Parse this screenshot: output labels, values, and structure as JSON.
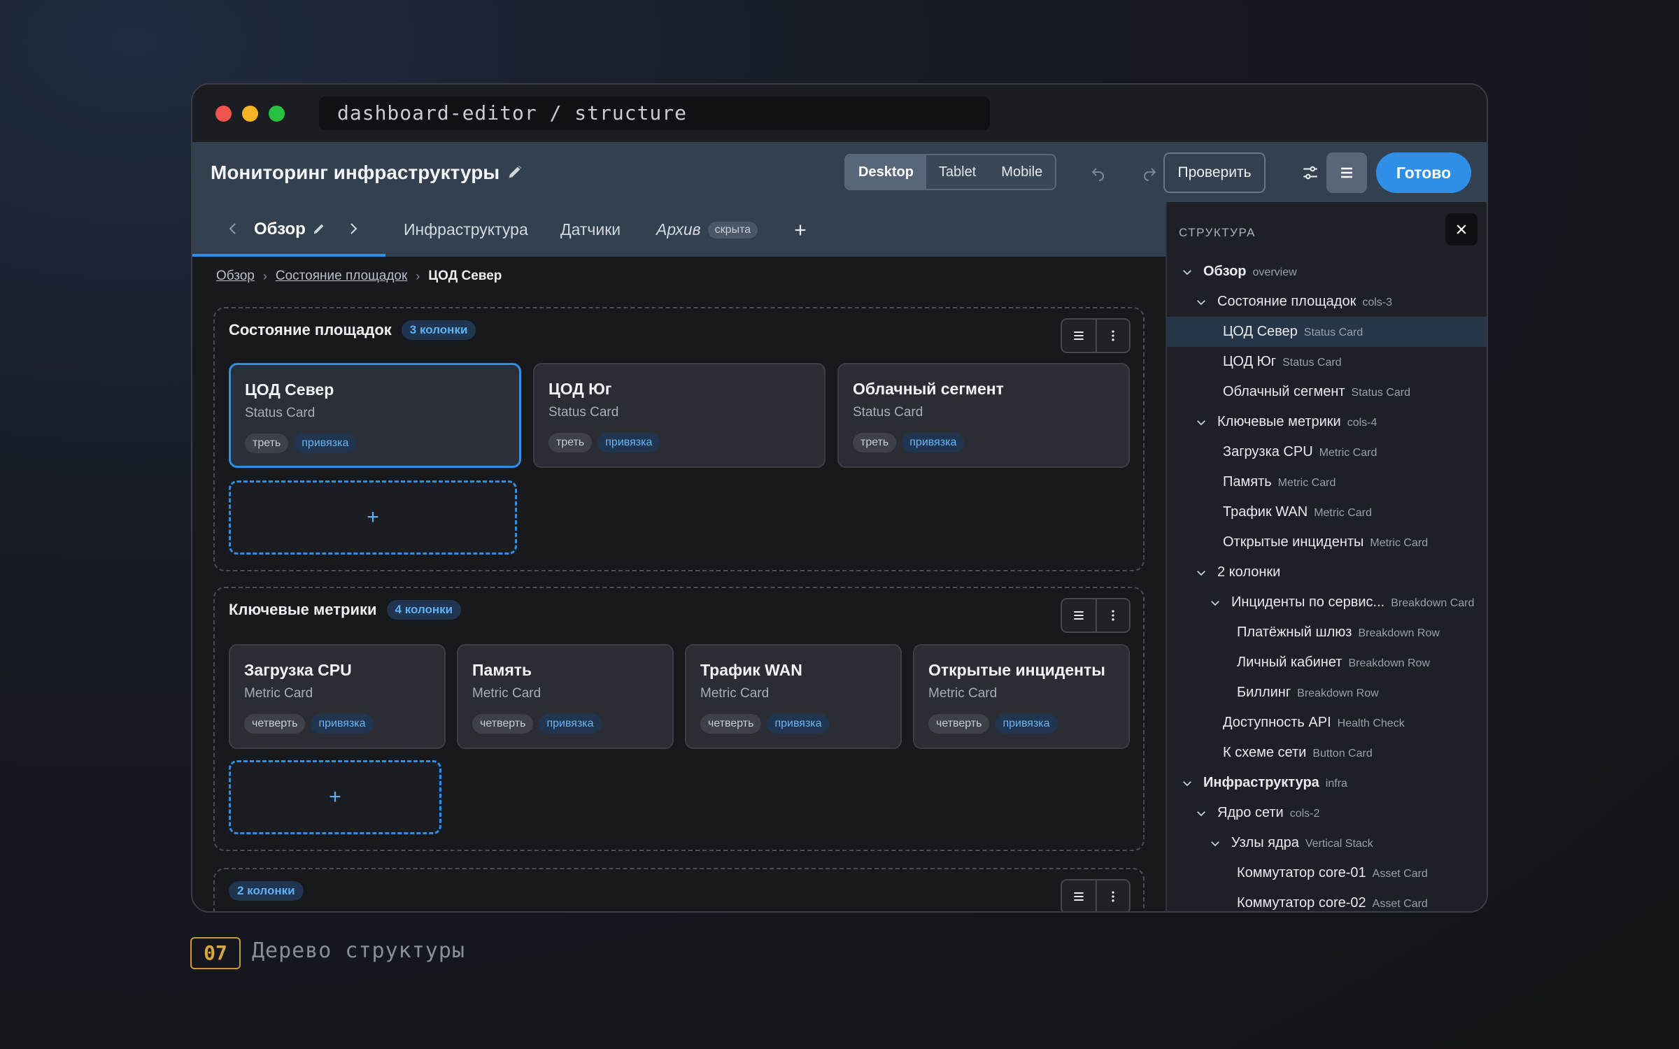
{
  "window": {
    "address": "dashboard-editor / structure"
  },
  "header": {
    "title": "Мониторинг инфраструктуры",
    "devices": [
      "Desktop",
      "Tablet",
      "Mobile"
    ],
    "active_device": "Desktop",
    "check_label": "Проверить",
    "done_label": "Готово"
  },
  "tabs": {
    "active": "Обзор",
    "items": [
      {
        "label": "Инфраструктура"
      },
      {
        "label": "Датчики"
      },
      {
        "label": "Архив",
        "badge": "скрыта"
      }
    ]
  },
  "breadcrumb": {
    "items": [
      "Обзор",
      "Состояние площадок"
    ],
    "current": "ЦОД Север"
  },
  "sections": [
    {
      "title": "Состояние площадок",
      "badge": "3 колонки",
      "cards": [
        {
          "title": "ЦОД Север",
          "type": "Status Card",
          "size": "треть",
          "bind": "привязка",
          "selected": true
        },
        {
          "title": "ЦОД Юг",
          "type": "Status Card",
          "size": "треть",
          "bind": "привязка"
        },
        {
          "title": "Облачный сегмент",
          "type": "Status Card",
          "size": "треть",
          "bind": "привязка"
        }
      ],
      "add": "+"
    },
    {
      "title": "Ключевые метрики",
      "badge": "4 колонки",
      "cards": [
        {
          "title": "Загрузка CPU",
          "type": "Metric Card",
          "size": "четверть",
          "bind": "привязка"
        },
        {
          "title": "Память",
          "type": "Metric Card",
          "size": "четверть",
          "bind": "привязка"
        },
        {
          "title": "Трафик WAN",
          "type": "Metric Card",
          "size": "четверть",
          "bind": "привязка"
        },
        {
          "title": "Открытые инциденты",
          "type": "Metric Card",
          "size": "четверть",
          "bind": "привязка"
        }
      ],
      "add": "+"
    },
    {
      "title": "",
      "badge": "2 колонки"
    }
  ],
  "panel": {
    "title": "СТРУКТУРА",
    "tree": [
      {
        "name": "Обзор",
        "type": "overview",
        "level": 0,
        "expanded": true,
        "bold": true
      },
      {
        "name": "Состояние площадок",
        "type": "cols-3",
        "level": 1,
        "expanded": true
      },
      {
        "name": "ЦОД Север",
        "type": "Status Card",
        "level": 2,
        "selected": true
      },
      {
        "name": "ЦОД Юг",
        "type": "Status Card",
        "level": 2
      },
      {
        "name": "Облачный сегмент",
        "type": "Status Card",
        "level": 2
      },
      {
        "name": "Ключевые метрики",
        "type": "cols-4",
        "level": 1,
        "expanded": true
      },
      {
        "name": "Загрузка CPU",
        "type": "Metric Card",
        "level": 2
      },
      {
        "name": "Память",
        "type": "Metric Card",
        "level": 2
      },
      {
        "name": "Трафик WAN",
        "type": "Metric Card",
        "level": 2
      },
      {
        "name": "Открытые инциденты",
        "type": "Metric Card",
        "level": 2
      },
      {
        "name": "2 колонки",
        "type": "",
        "level": 1,
        "expanded": true
      },
      {
        "name": "Инциденты по сервис...",
        "type": "Breakdown Card",
        "level": 2,
        "expanded": true
      },
      {
        "name": "Платёжный шлюз",
        "type": "Breakdown Row",
        "level": 3
      },
      {
        "name": "Личный кабинет",
        "type": "Breakdown Row",
        "level": 3
      },
      {
        "name": "Биллинг",
        "type": "Breakdown Row",
        "level": 3
      },
      {
        "name": "Доступность API",
        "type": "Health Check",
        "level": 2
      },
      {
        "name": "К схеме сети",
        "type": "Button Card",
        "level": 2
      },
      {
        "name": "Инфраструктура",
        "type": "infra",
        "level": 0,
        "expanded": true,
        "bold": true
      },
      {
        "name": "Ядро сети",
        "type": "cols-2",
        "level": 1,
        "expanded": true
      },
      {
        "name": "Узлы ядра",
        "type": "Vertical Stack",
        "level": 2,
        "expanded": true
      },
      {
        "name": "Коммутатор core-01",
        "type": "Asset Card",
        "level": 3
      },
      {
        "name": "Коммутатор core-02",
        "type": "Asset Card",
        "level": 3
      }
    ]
  },
  "footer": {
    "number": "07",
    "caption": "Дерево структуры"
  },
  "colors": {
    "accent": "#2f8fe6",
    "header": "#33404f",
    "canvas": "#18191d"
  }
}
